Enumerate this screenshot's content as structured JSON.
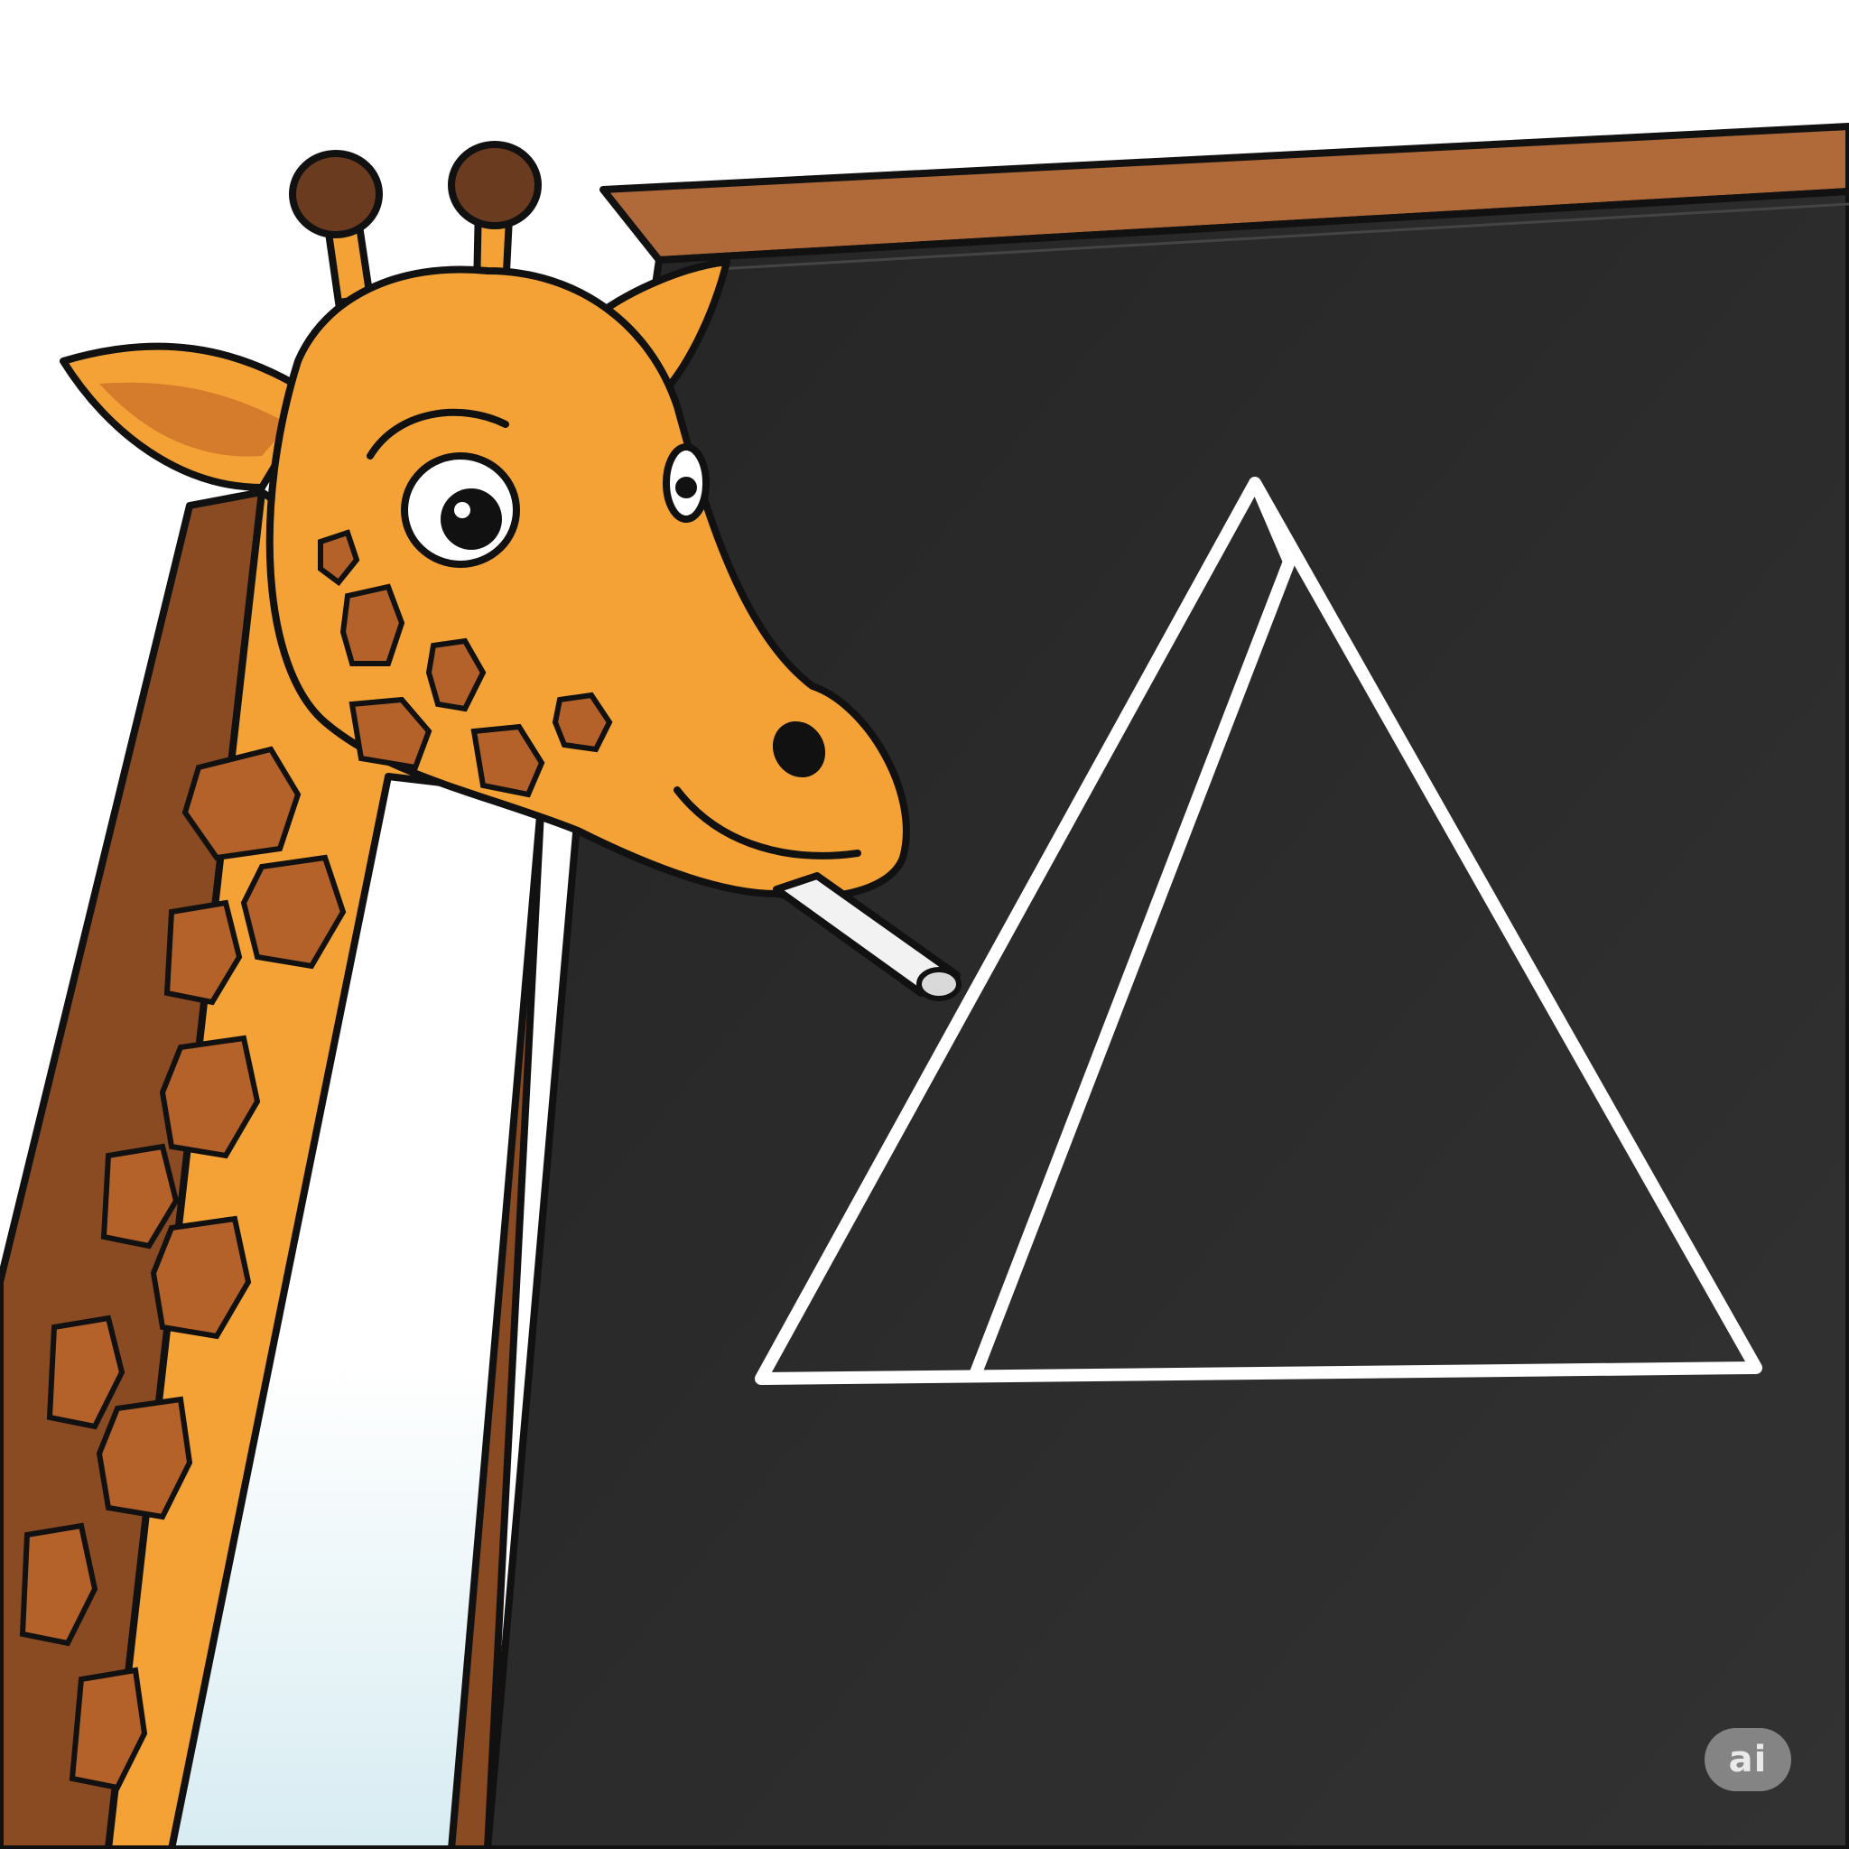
{
  "scene": {
    "subject": "giraffe",
    "object_in_mouth": "chalk",
    "board": "chalkboard",
    "drawing": "triangle"
  },
  "colors": {
    "background": "#ffffff",
    "chalkboard": "#2d2d2d",
    "board_frame": "#b06a3a",
    "giraffe_body": "#f4a236",
    "giraffe_spots": "#b5622a",
    "outline": "#111111",
    "chalk_line": "#ffffff"
  },
  "watermark": {
    "label": "ai",
    "icon": "ai-badge-icon"
  }
}
